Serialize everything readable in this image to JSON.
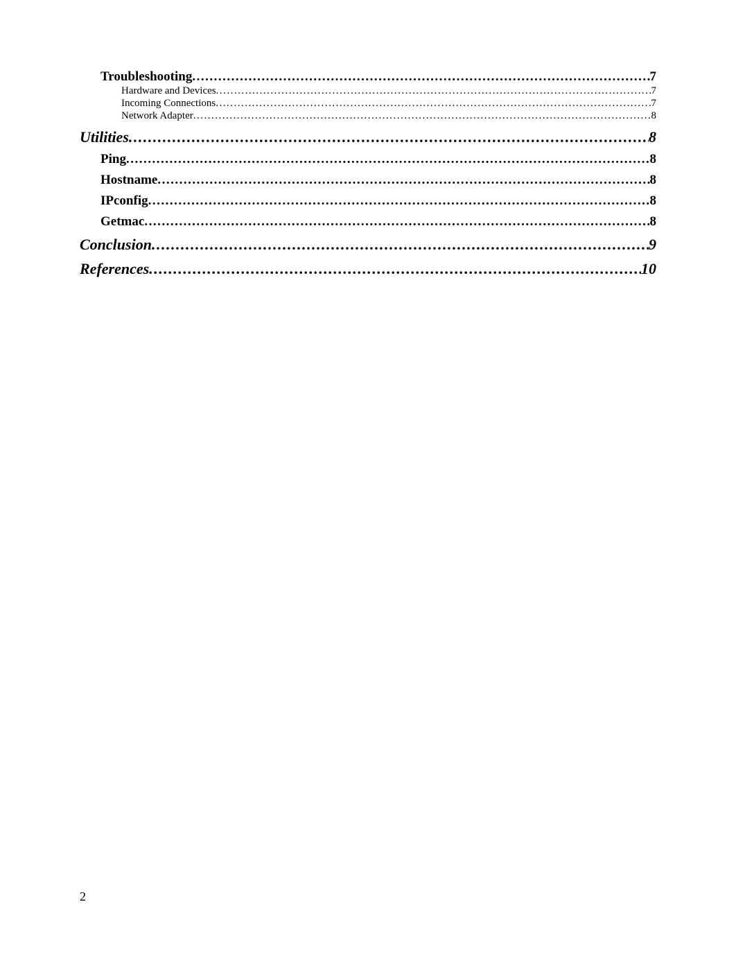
{
  "toc": {
    "entries": [
      {
        "level": "level-2",
        "title": "Troubleshooting",
        "page": "7",
        "spaced": false
      },
      {
        "level": "level-3",
        "title": "Hardware and Devices",
        "page": "7",
        "spaced": false
      },
      {
        "level": "level-3",
        "title": "Incoming Connections",
        "page": "7",
        "spaced": false
      },
      {
        "level": "level-3",
        "title": "Network Adapter",
        "page": " 8",
        "spaced": false
      },
      {
        "level": "level-1",
        "title": "Utilities",
        "page": " 8",
        "spaced": false
      },
      {
        "level": "level-2",
        "title": "Ping",
        "page": "8",
        "spaced": true
      },
      {
        "level": "level-2",
        "title": "Hostname",
        "page": " 8",
        "spaced": true
      },
      {
        "level": "level-2",
        "title": "IPconfig",
        "page": " 8",
        "spaced": true
      },
      {
        "level": "level-2",
        "title": "Getmac",
        "page": " 8",
        "spaced": true
      },
      {
        "level": "level-1",
        "title": "Conclusion",
        "page": " 9",
        "spaced": false
      },
      {
        "level": "level-1",
        "title": "References",
        "page": "10",
        "spaced": false
      }
    ]
  },
  "dots": "............................................................................................................................................................................................................................................",
  "page_number": "2"
}
